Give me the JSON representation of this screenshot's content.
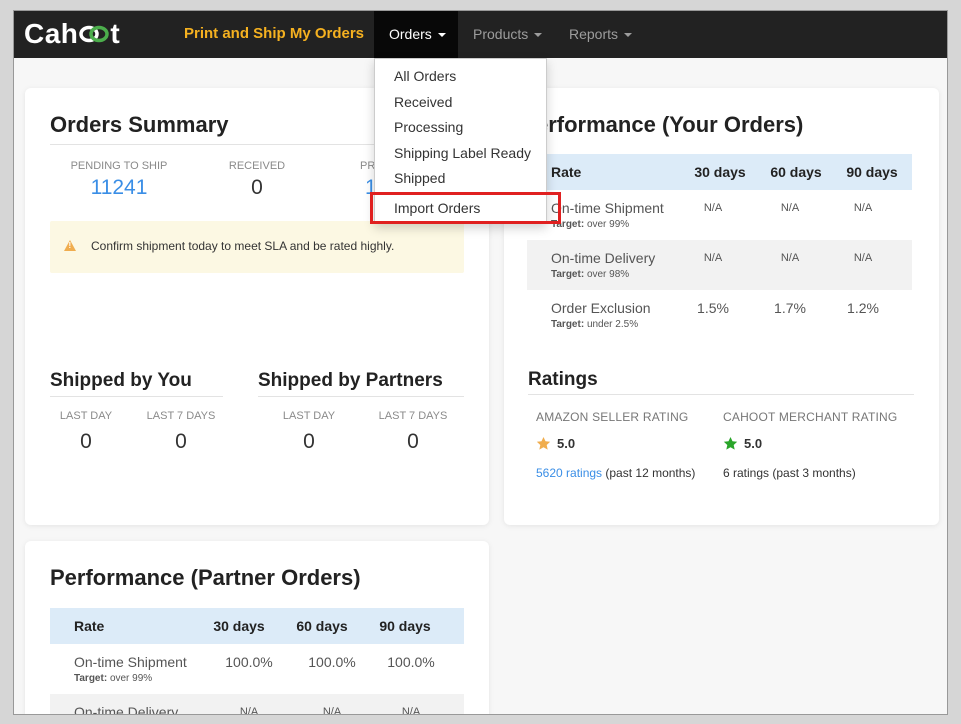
{
  "brand": {
    "name_left": "Cah",
    "name_right": "t"
  },
  "nav": {
    "cta": "Print and Ship My Orders",
    "orders": "Orders",
    "products": "Products",
    "reports": "Reports"
  },
  "dropdown": {
    "items": [
      "All Orders",
      "Received",
      "Processing",
      "Shipping Label Ready",
      "Shipped",
      "Import Orders"
    ]
  },
  "summary": {
    "title": "Orders Summary",
    "pending_label": "PENDING TO SHIP",
    "pending_value": "11241",
    "received_label": "RECEIVED",
    "received_value": "0",
    "processing_label_partial": "PR",
    "processing_value_partial": "1",
    "alert": "Confirm shipment today to meet SLA and be rated highly."
  },
  "shipped_you": {
    "title": "Shipped by You",
    "last_day_label": "LAST DAY",
    "last_day": "0",
    "last7_label": "LAST 7 DAYS",
    "last7": "0"
  },
  "shipped_partners": {
    "title": "Shipped by Partners",
    "last_day_label": "LAST DAY",
    "last_day": "0",
    "last7_label": "LAST 7 DAYS",
    "last7": "0"
  },
  "perf_yours": {
    "title": "erformance (Your Orders)",
    "headers": [
      "Rate",
      "30 days",
      "60 days",
      "90 days"
    ],
    "rows": [
      {
        "name": "On-time Shipment",
        "target_label": "Target:",
        "target": "over 99%",
        "v30": "N/A",
        "v60": "N/A",
        "v90": "N/A"
      },
      {
        "name": "On-time Delivery",
        "target_label": "Target:",
        "target": "over 98%",
        "v30": "N/A",
        "v60": "N/A",
        "v90": "N/A"
      },
      {
        "name": "Order Exclusion",
        "target_label": "Target:",
        "target": "under 2.5%",
        "v30": "1.5%",
        "v60": "1.7%",
        "v90": "1.2%"
      }
    ]
  },
  "ratings": {
    "title": "Ratings",
    "amazon_label": "AMAZON SELLER RATING",
    "amazon_score": "5.0",
    "amazon_link": "5620 ratings",
    "amazon_period": "(past 12 months)",
    "cahoot_label": "CAHOOT MERCHANT RATING",
    "cahoot_score": "5.0",
    "cahoot_sub": "6 ratings (past 3 months)",
    "amazon_star_color": "#f0ad4e",
    "cahoot_star_color": "#2aa52a"
  },
  "perf_partner": {
    "title": "Performance (Partner Orders)",
    "headers": [
      "Rate",
      "30 days",
      "60 days",
      "90 days"
    ],
    "rows": [
      {
        "name": "On-time Shipment",
        "target_label": "Target:",
        "target": "over 99%",
        "v30": "100.0%",
        "v60": "100.0%",
        "v90": "100.0%"
      },
      {
        "name": "On-time Delivery",
        "v30": "N/A",
        "v60": "N/A",
        "v90": "N/A"
      }
    ]
  }
}
